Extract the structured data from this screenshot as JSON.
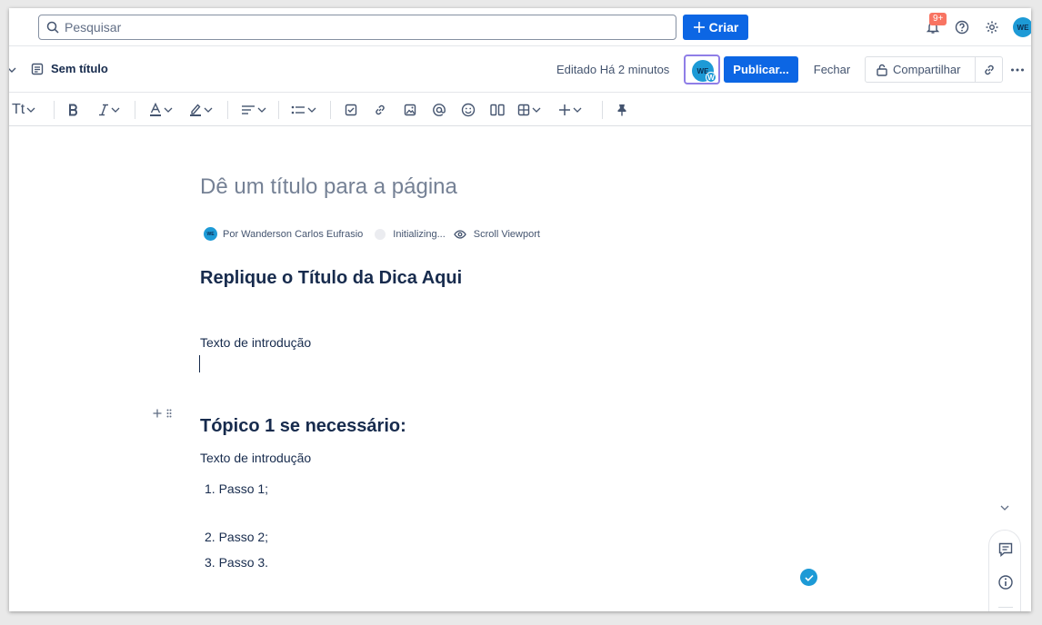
{
  "topnav": {
    "search_placeholder": "Pesquisar",
    "create_label": "Criar",
    "notifications_badge": "9+",
    "user_initials": "WE"
  },
  "header": {
    "page_name": "Sem título",
    "edited_status": "Editado Há 2 minutos",
    "collaborator_initials": "WE",
    "collaborator_badge": "W",
    "publish_label": "Publicar...",
    "close_label": "Fechar",
    "share_label": "Compartilhar"
  },
  "toolbar": {
    "text_style_label": "Tt"
  },
  "content": {
    "title_placeholder": "Dê um título para a página",
    "byline_author": "Por Wanderson Carlos Eufrasio",
    "byline_status": "Initializing...",
    "byline_app": "Scroll Viewport",
    "author_initials": "WE",
    "heading_main": "Replique o Título da Dica Aqui",
    "intro_1": "Texto de introdução",
    "heading_topic": "Tópico 1 se necessário:",
    "intro_2": "Texto de introdução",
    "list": [
      "1. Passo 1;",
      "2. Passo 2;",
      "3. Passo 3."
    ]
  },
  "colors": {
    "primary": "#0c66e4",
    "avatar": "#1d9ad6",
    "badge": "#f87462",
    "collab_border": "#8f7ee7"
  }
}
